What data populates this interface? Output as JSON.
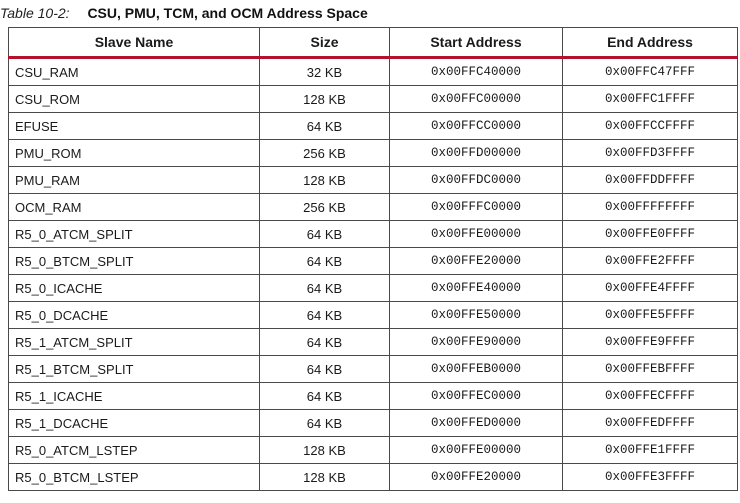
{
  "caption": {
    "label": "Table 10-2:",
    "title": "CSU, PMU, TCM, and OCM Address Space"
  },
  "table": {
    "headers": [
      "Slave Name",
      "Size",
      "Start Address",
      "End Address"
    ],
    "rows": [
      {
        "name": "CSU_RAM",
        "size": "32 KB",
        "start": "0x00FFC40000",
        "end": "0x00FFC47FFF"
      },
      {
        "name": "CSU_ROM",
        "size": "128 KB",
        "start": "0x00FFC00000",
        "end": "0x00FFC1FFFF"
      },
      {
        "name": "EFUSE",
        "size": "64 KB",
        "start": "0x00FFCC0000",
        "end": "0x00FFCCFFFF"
      },
      {
        "name": "PMU_ROM",
        "size": "256 KB",
        "start": "0x00FFD00000",
        "end": "0x00FFD3FFFF"
      },
      {
        "name": "PMU_RAM",
        "size": "128 KB",
        "start": "0x00FFDC0000",
        "end": "0x00FFDDFFFF"
      },
      {
        "name": "OCM_RAM",
        "size": "256 KB",
        "start": "0x00FFFC0000",
        "end": "0x00FFFFFFFF"
      },
      {
        "name": "R5_0_ATCM_SPLIT",
        "size": "64 KB",
        "start": "0x00FFE00000",
        "end": "0x00FFE0FFFF"
      },
      {
        "name": "R5_0_BTCM_SPLIT",
        "size": "64 KB",
        "start": "0x00FFE20000",
        "end": "0x00FFE2FFFF"
      },
      {
        "name": "R5_0_ICACHE",
        "size": "64 KB",
        "start": "0x00FFE40000",
        "end": "0x00FFE4FFFF"
      },
      {
        "name": "R5_0_DCACHE",
        "size": "64 KB",
        "start": "0x00FFE50000",
        "end": "0x00FFE5FFFF"
      },
      {
        "name": "R5_1_ATCM_SPLIT",
        "size": "64 KB",
        "start": "0x00FFE90000",
        "end": "0x00FFE9FFFF"
      },
      {
        "name": "R5_1_BTCM_SPLIT",
        "size": "64 KB",
        "start": "0x00FFEB0000",
        "end": "0x00FFEBFFFF"
      },
      {
        "name": "R5_1_ICACHE",
        "size": "64 KB",
        "start": "0x00FFEC0000",
        "end": "0x00FFECFFFF"
      },
      {
        "name": "R5_1_DCACHE",
        "size": "64 KB",
        "start": "0x00FFED0000",
        "end": "0x00FFEDFFFF"
      },
      {
        "name": "R5_0_ATCM_LSTEP",
        "size": "128 KB",
        "start": "0x00FFE00000",
        "end": "0x00FFE1FFFF"
      },
      {
        "name": "R5_0_BTCM_LSTEP",
        "size": "128 KB",
        "start": "0x00FFE20000",
        "end": "0x00FFE3FFFF"
      }
    ]
  },
  "colors": {
    "header_rule": "#b3122e",
    "border": "#4a4a4a"
  }
}
